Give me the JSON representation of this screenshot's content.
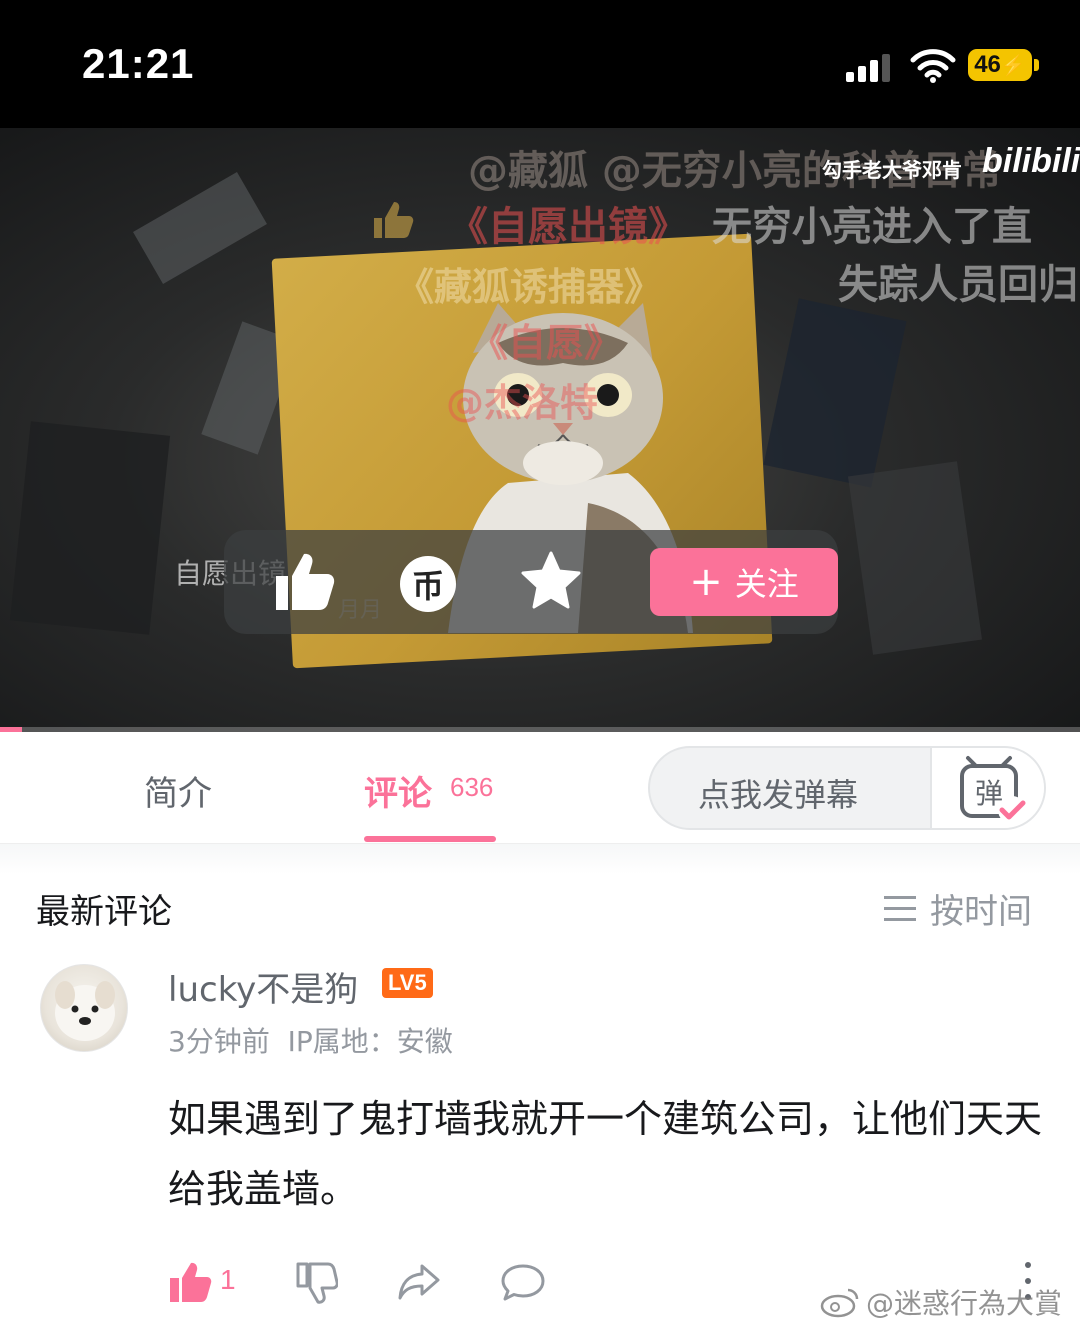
{
  "status_bar": {
    "time": "21:21",
    "battery": "46"
  },
  "video": {
    "danmaku": [
      "@藏狐  @无穷小亮的科普日常",
      "《自愿出镜》",
      "无穷小亮进入了直",
      "《藏狐诱捕器》",
      "失踪人员回归",
      "《自愿》",
      "@杰洛特"
    ],
    "uploader_watermark": "勾手老大爷邓肯",
    "logo": "bilibili",
    "caption": "自愿出镜",
    "subcaption": "月月",
    "follow_label": "关注",
    "coin_glyph": "币",
    "progress": 0.02
  },
  "tabs": {
    "intro": "简介",
    "comments": "评论",
    "comments_count": "636",
    "danmaku_placeholder": "点我发弹幕",
    "danmaku_toggle_glyph": "弹"
  },
  "comments": {
    "section_title": "最新评论",
    "sort_label": "按时间",
    "items": [
      {
        "username": "lucky不是狗",
        "level": "LV5",
        "time": "3分钟前",
        "ip": "IP属地：安徽",
        "text": "如果遇到了鬼打墙我就开一个建筑公司，让他们天天给我盖墙。",
        "likes": "1"
      }
    ]
  },
  "watermark": "@迷惑行為大賞",
  "colors": {
    "accent": "#fb7299",
    "level": "#ff6a17"
  }
}
